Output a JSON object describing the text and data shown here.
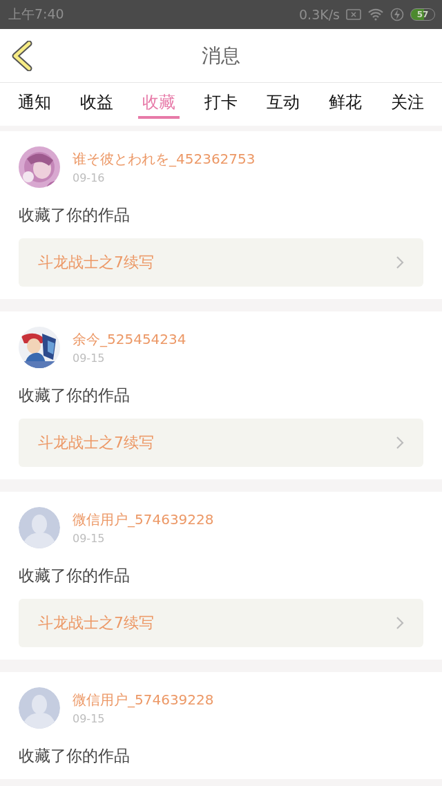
{
  "status_bar": {
    "time": "上午7:40",
    "speed": "0.3K/s",
    "battery": "57"
  },
  "header": {
    "title": "消息"
  },
  "tabs": [
    {
      "label": "通知",
      "selected": false
    },
    {
      "label": "收益",
      "selected": false
    },
    {
      "label": "收藏",
      "selected": true
    },
    {
      "label": "打卡",
      "selected": false
    },
    {
      "label": "互动",
      "selected": false
    },
    {
      "label": "鲜花",
      "selected": false
    },
    {
      "label": "关注",
      "selected": false
    }
  ],
  "messages": [
    {
      "user": "谁そ彼とわれを_452362753",
      "date": "09-16",
      "text": "收藏了你的作品",
      "work": "斗龙战士之7续写"
    },
    {
      "user": "余今_525454234",
      "date": "09-15",
      "text": "收藏了你的作品",
      "work": "斗龙战士之7续写"
    },
    {
      "avatar": {
        "kind": "default"
      },
      "user": "微信用户_574639228",
      "date": "09-15",
      "text": "收藏了你的作品",
      "work": "斗龙战士之7续写"
    },
    {
      "avatar": {
        "kind": "default"
      },
      "user": "微信用户_574639228",
      "date": "09-15",
      "text": "收藏了你的作品"
    }
  ]
}
